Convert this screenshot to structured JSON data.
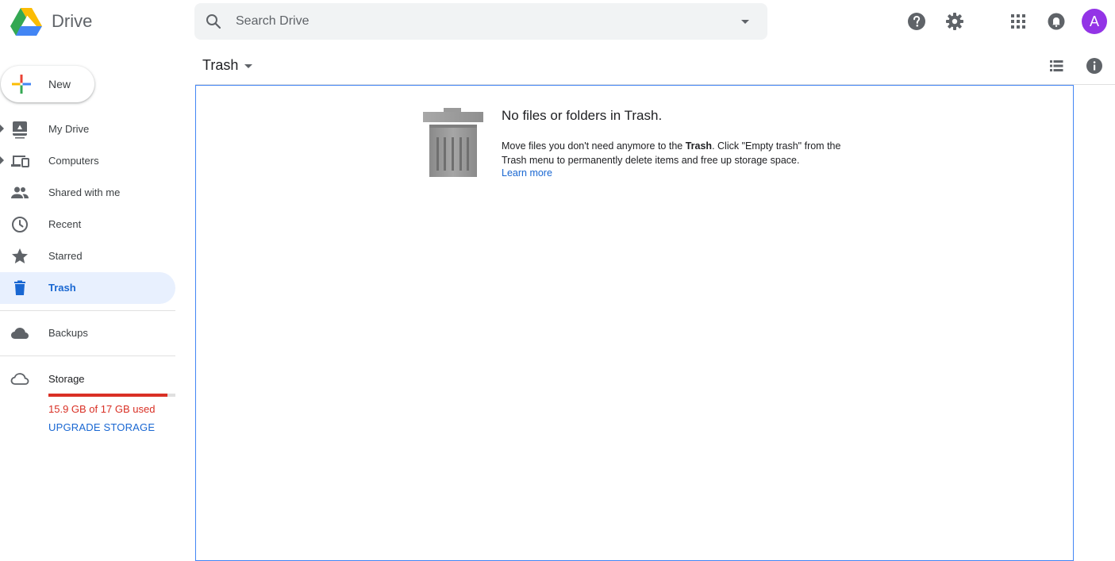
{
  "app": {
    "name": "Drive"
  },
  "search": {
    "placeholder": "Search Drive"
  },
  "header": {
    "help_icon": "help-icon",
    "settings_icon": "gear-icon",
    "apps_icon": "apps-grid-icon",
    "notifications_icon": "bell-icon",
    "avatar_letter": "A",
    "avatar_color": "#9334e6"
  },
  "new_button": {
    "label": "New"
  },
  "sidebar": {
    "items": [
      {
        "label": "My Drive",
        "icon": "my-drive-icon",
        "expandable": true
      },
      {
        "label": "Computers",
        "icon": "computers-icon",
        "expandable": true
      },
      {
        "label": "Shared with me",
        "icon": "people-icon"
      },
      {
        "label": "Recent",
        "icon": "clock-icon"
      },
      {
        "label": "Starred",
        "icon": "star-icon"
      },
      {
        "label": "Trash",
        "icon": "trash-icon",
        "active": true
      }
    ],
    "backups": {
      "label": "Backups",
      "icon": "cloud-icon"
    },
    "storage": {
      "label": "Storage",
      "icon": "cloud-outline-icon",
      "used_text": "15.9 GB of 17 GB used",
      "used_fraction": 0.935,
      "upgrade_label": "UPGRADE STORAGE"
    }
  },
  "main": {
    "title": "Trash",
    "list_view_icon": "list-view-icon",
    "info_icon": "info-icon",
    "empty": {
      "title": "No files or folders in Trash.",
      "desc_before": "Move files you don't need anymore to the ",
      "desc_bold": "Trash",
      "desc_after": ". Click \"Empty trash\" from the Trash menu to permanently delete items and free up storage space.",
      "learn_more": "Learn more"
    }
  },
  "colors": {
    "accent": "#1967d2",
    "active_bg": "#e8f0fe",
    "warning": "#d93025",
    "selection_border": "#4285f4"
  }
}
